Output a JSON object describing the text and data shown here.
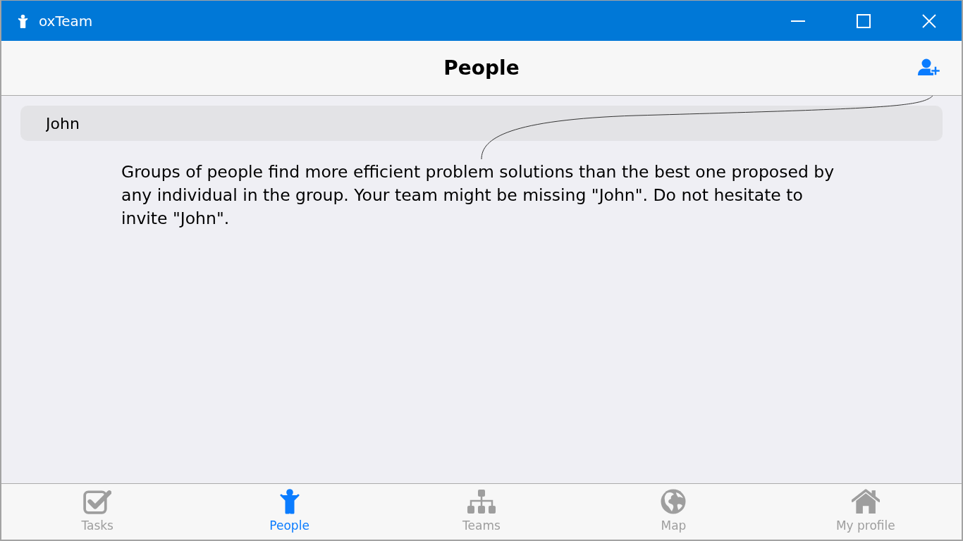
{
  "window": {
    "title": "oxTeam"
  },
  "header": {
    "title": "People"
  },
  "search": {
    "value": "John"
  },
  "hint": {
    "text": "Groups of people find more efficient problem solutions than the best one proposed by any individual in the group. Your team might be missing \"John\". Do not hesitate to invite \"John\"."
  },
  "tab_bar": {
    "tabs": [
      {
        "label": "Tasks",
        "kind": "tasks",
        "selected": false
      },
      {
        "label": "People",
        "kind": "people",
        "selected": true
      },
      {
        "label": "Teams",
        "kind": "teams",
        "selected": false
      },
      {
        "label": "Map",
        "kind": "map",
        "selected": false
      },
      {
        "label": "My profile",
        "kind": "profile",
        "selected": false
      }
    ]
  }
}
